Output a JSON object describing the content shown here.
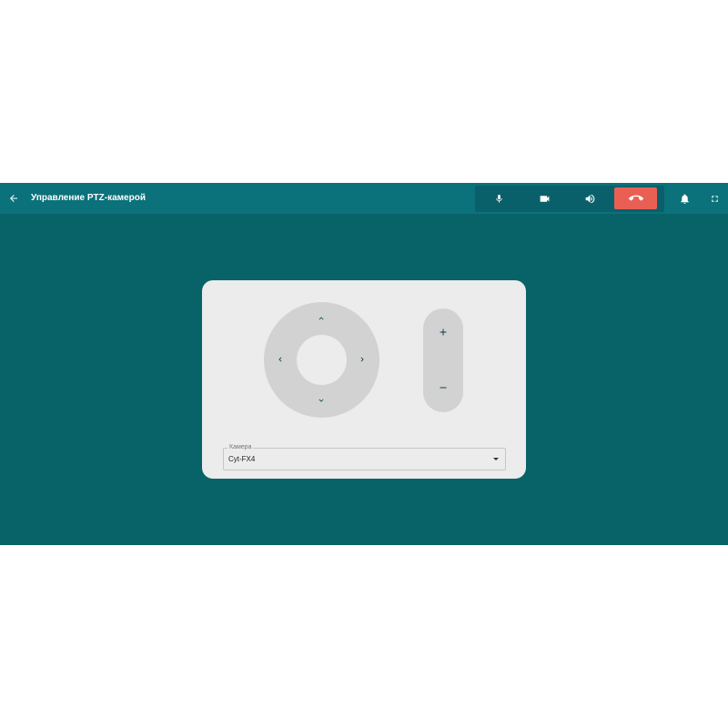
{
  "header": {
    "title": "Управление PTZ-камерой",
    "back_icon": "arrow-left-icon",
    "bell_icon": "bell-icon",
    "fullscreen_icon": "fullscreen-icon"
  },
  "call_controls": {
    "mic_icon": "microphone-icon",
    "camera_icon": "video-camera-icon",
    "volume_icon": "speaker-volume-icon",
    "end_call_icon": "phone-hangup-icon",
    "end_call_color": "#ea5f53"
  },
  "ptz": {
    "directions": [
      "up",
      "down",
      "left",
      "right"
    ],
    "zoom_in_symbol": "+",
    "zoom_out_symbol": "–",
    "camera_select": {
      "label": "Камера",
      "value": "Cyt-FX4"
    }
  },
  "colors": {
    "page_bg": "#086369",
    "topbar_bg": "#0b717b",
    "panel_bg": "#ececec",
    "control_bg": "#d2d2d2",
    "accent_dark": "#0d3f45"
  }
}
